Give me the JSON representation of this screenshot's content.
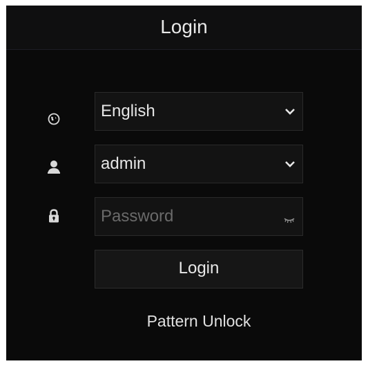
{
  "dialog": {
    "title": "Login"
  },
  "language": {
    "icon": "globe-icon",
    "value": "English"
  },
  "username": {
    "icon": "user-icon",
    "value": "admin"
  },
  "password": {
    "icon": "lock-icon",
    "placeholder": "Password",
    "toggle_icon": "eye-closed-icon"
  },
  "actions": {
    "login_label": "Login",
    "pattern_unlock_label": "Pattern Unlock"
  }
}
